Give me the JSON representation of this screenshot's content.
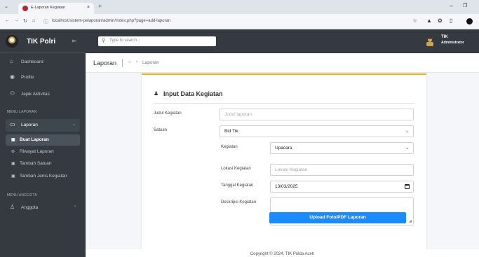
{
  "browser": {
    "tab_title": "E-Laporan Kegiatan",
    "url": "localhost/sistem-pelaporan/admin/index.php?page=add-laporan"
  },
  "sidebar": {
    "brand": "TIK Polri",
    "items_main": [
      {
        "label": "Dashboard"
      },
      {
        "label": "Profile"
      },
      {
        "label": "Jejak Aktivitas"
      }
    ],
    "header_laporan": "MENU LAPORAN",
    "laporan_label": "Laporan",
    "sub_items": [
      {
        "label": "Buat Laporan"
      },
      {
        "label": "Riwayat Laporan"
      },
      {
        "label": "Tambah Satuan"
      },
      {
        "label": "Tambah Jenis Kegiatan"
      }
    ],
    "header_anggota": "MENU ANGGOTA",
    "anggota_label": "Anggota"
  },
  "topnav": {
    "search_placeholder": "Type to search...",
    "user_name": "TIK",
    "user_role": "Administrator"
  },
  "page": {
    "title": "Laporan",
    "breadcrumb": "Laporan"
  },
  "form": {
    "card_title": "Input Data Kegiatan",
    "judul_label": "Judul Kegiatan",
    "judul_placeholder": "Judul laporan",
    "satuan_label": "Satuan",
    "satuan_value": "Bid Tik",
    "kegiatan_label": "Kegiatan",
    "kegiatan_value": "Upacara",
    "lokasi_label": "Lokasi Kegiatan",
    "lokasi_placeholder": "Lokasi Kegiatan",
    "tanggal_label": "Tanggal Kegiatan",
    "tanggal_value": "13/03/2025",
    "deskripsi_label": "Deskripsi Kegiatan",
    "upload_label": "Upload Foto/PDF Laporan"
  },
  "footer": {
    "copyright": "Copyright © 2024, TIK Polda Aceh"
  }
}
